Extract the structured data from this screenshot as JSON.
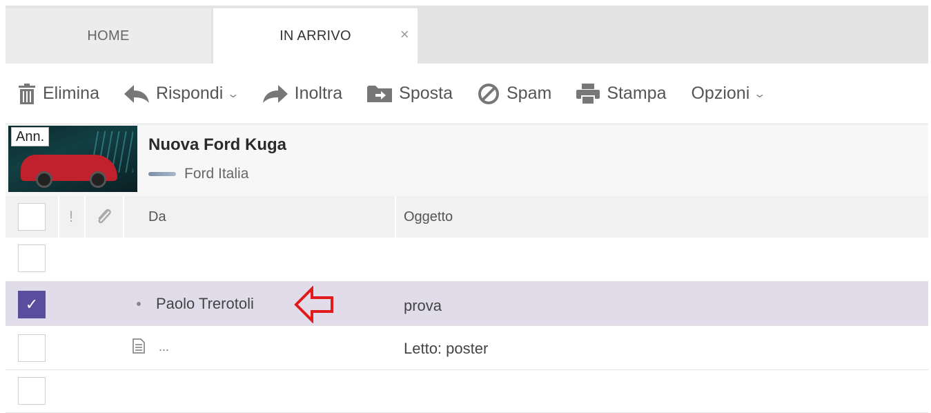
{
  "tabs": {
    "home": "HOME",
    "inarrivo": "IN ARRIVO",
    "close": "×"
  },
  "toolbar": {
    "elimina": "Elimina",
    "rispondi": "Rispondi",
    "inoltra": "Inoltra",
    "sposta": "Sposta",
    "spam": "Spam",
    "stampa": "Stampa",
    "opzioni": "Opzioni",
    "chevron": "⌄"
  },
  "ad": {
    "label": "Ann.",
    "title": "Nuova Ford Kuga",
    "sender": "Ford Italia"
  },
  "columns": {
    "importance": "!",
    "da": "Da",
    "oggetto": "Oggetto"
  },
  "rows": [
    {
      "da": "",
      "oggetto": "",
      "selected": false
    },
    {
      "da": "Paolo Trerotoli",
      "oggetto": "prova",
      "selected": true,
      "check": "✓"
    },
    {
      "da": "...",
      "oggetto": "Letto: poster",
      "selected": false
    },
    {
      "da": "",
      "oggetto": "",
      "selected": false
    }
  ],
  "colors": {
    "selected_row": "#e0dcea",
    "checkbox_checked": "#5b4d9e",
    "annotation_arrow": "#e11b1b"
  }
}
